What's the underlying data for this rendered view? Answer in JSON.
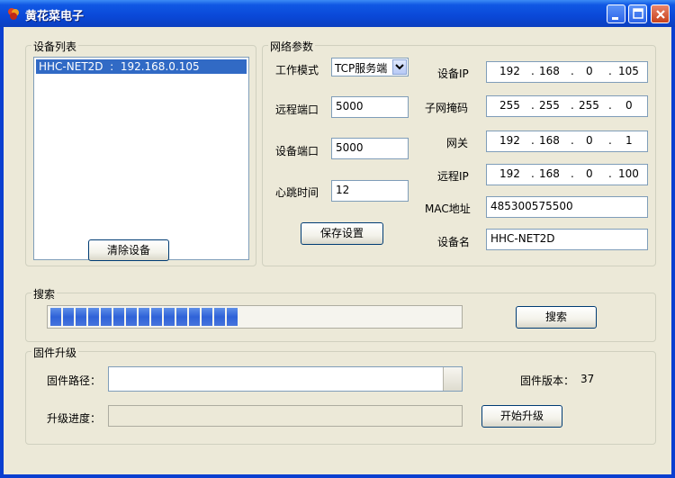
{
  "window": {
    "title": "黄花菜电子"
  },
  "device_list": {
    "group_label": "设备列表",
    "items": [
      "HHC-NET2D  :  192.168.0.105"
    ],
    "clear_button": "清除设备"
  },
  "network": {
    "group_label": "网络参数",
    "mode_label": "工作模式",
    "mode_value": "TCP服务端",
    "remote_port_label": "远程端口",
    "remote_port_value": "5000",
    "device_port_label": "设备端口",
    "device_port_value": "5000",
    "heartbeat_label": "心跳时间",
    "heartbeat_value": "12",
    "save_button": "保存设置",
    "device_ip_label": "设备IP",
    "device_ip": [
      "192",
      "168",
      "0",
      "105"
    ],
    "subnet_label": "子网掩码",
    "subnet": [
      "255",
      "255",
      "255",
      "0"
    ],
    "gateway_label": "网关",
    "gateway": [
      "192",
      "168",
      "0",
      "1"
    ],
    "remote_ip_label": "远程IP",
    "remote_ip": [
      "192",
      "168",
      "0",
      "100"
    ],
    "mac_label": "MAC地址",
    "mac_value": "485300575500",
    "device_name_label": "设备名",
    "device_name_value": "HHC-NET2D"
  },
  "search": {
    "group_label": "搜索",
    "button": "搜索",
    "progress_segments_filled": 15
  },
  "firmware": {
    "group_label": "固件升级",
    "path_label": "固件路径：",
    "path_value": "",
    "version_label": "固件版本：",
    "version_value": "37",
    "progress_label": "升级进度：",
    "upgrade_button": "开始升级"
  },
  "colors": {
    "titlebar": "#0a48d8",
    "selection": "#316ac5",
    "progress": "#2f62d8",
    "dialog": "#ece9d8"
  }
}
